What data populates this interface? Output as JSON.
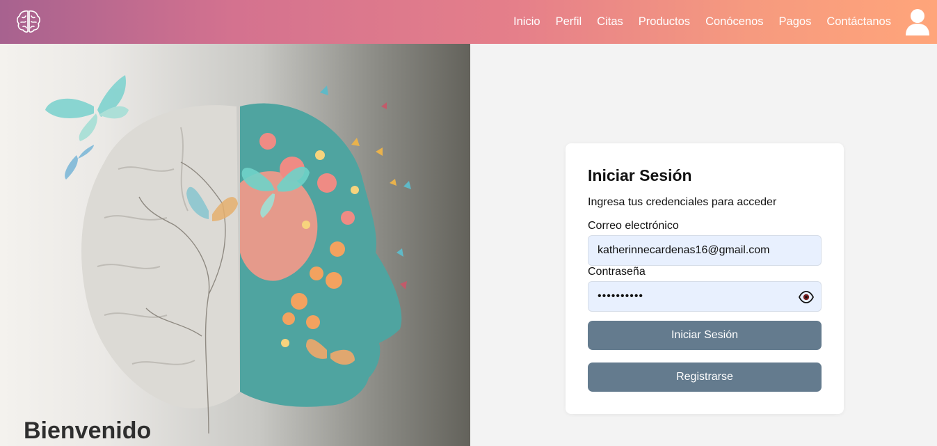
{
  "nav": {
    "brand_icon": "brain-icon",
    "links": [
      "Inicio",
      "Perfil",
      "Citas",
      "Productos",
      "Conócenos",
      "Pagos",
      "Contáctanos"
    ],
    "user_icon": "user-avatar-icon"
  },
  "hero": {
    "welcome": "Bienvenido"
  },
  "login": {
    "title": "Iniciar Sesión",
    "subtitle": "Ingresa tus credenciales para acceder",
    "email_label": "Correo electrónico",
    "email_value": "katherinnecardenas16@gmail.com",
    "password_label": "Contraseña",
    "password_value": "••••••••••",
    "password_toggle_icon": "eye-icon",
    "submit_label": "Iniciar Sesión",
    "register_label": "Registrarse"
  },
  "colors": {
    "nav_gradient_start": "#a7628f",
    "nav_gradient_end": "#ffa57a",
    "button": "#647b8e",
    "input_bg": "#e8f0fe"
  }
}
